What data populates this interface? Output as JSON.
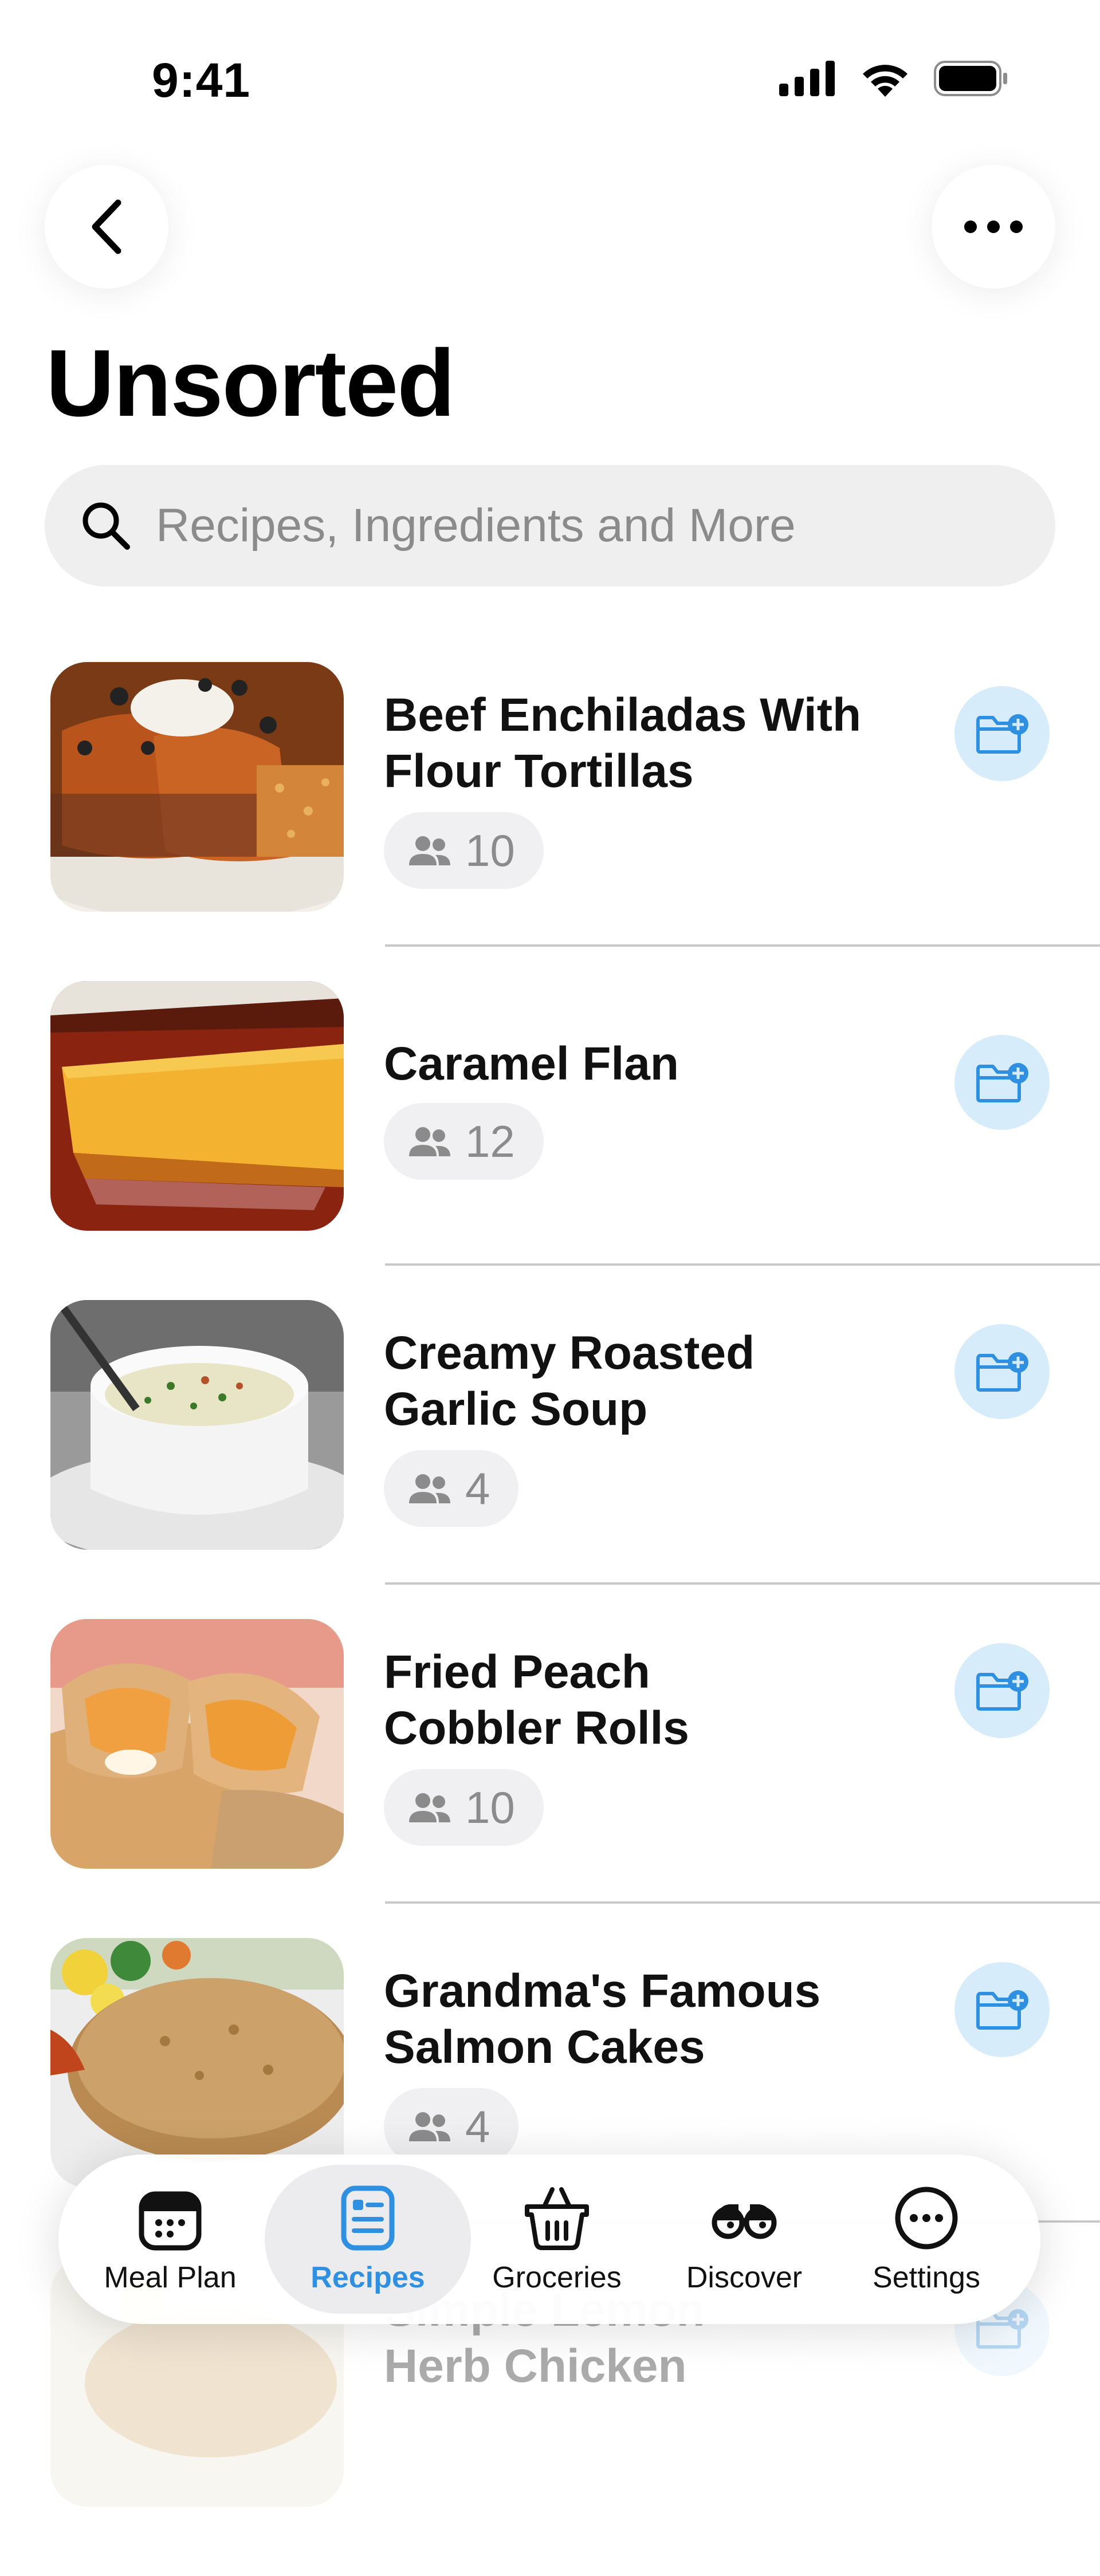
{
  "status_bar": {
    "time": "9:41"
  },
  "page": {
    "title": "Unsorted"
  },
  "search": {
    "placeholder": "Recipes, Ingredients and More"
  },
  "recipes": [
    {
      "title_line1": "Beef Enchiladas With",
      "title_line2": "Flour Tortillas",
      "servings": "10"
    },
    {
      "title_line1": "Caramel Flan",
      "title_line2": "",
      "servings": "12"
    },
    {
      "title_line1": "Creamy Roasted",
      "title_line2": "Garlic Soup",
      "servings": "4"
    },
    {
      "title_line1": "Fried Peach",
      "title_line2": "Cobbler Rolls",
      "servings": "10"
    },
    {
      "title_line1": "Grandma's Famous",
      "title_line2": "Salmon Cakes",
      "servings": "4"
    },
    {
      "title_line1": "Simple Lemon",
      "title_line2": "Herb Chicken",
      "servings": ""
    }
  ],
  "tab_bar": {
    "tabs": [
      {
        "label": "Meal Plan",
        "icon": "calendar-icon"
      },
      {
        "label": "Recipes",
        "icon": "recipe-card-icon",
        "active": true
      },
      {
        "label": "Groceries",
        "icon": "basket-icon"
      },
      {
        "label": "Discover",
        "icon": "binoculars-icon"
      },
      {
        "label": "Settings",
        "icon": "ellipsis-circle-icon"
      }
    ]
  },
  "colors": {
    "accent": "#2f8fe0",
    "add_button_bg": "#d6ecfb",
    "search_bg": "#efefef",
    "chip_bg": "#f0f0f2"
  }
}
